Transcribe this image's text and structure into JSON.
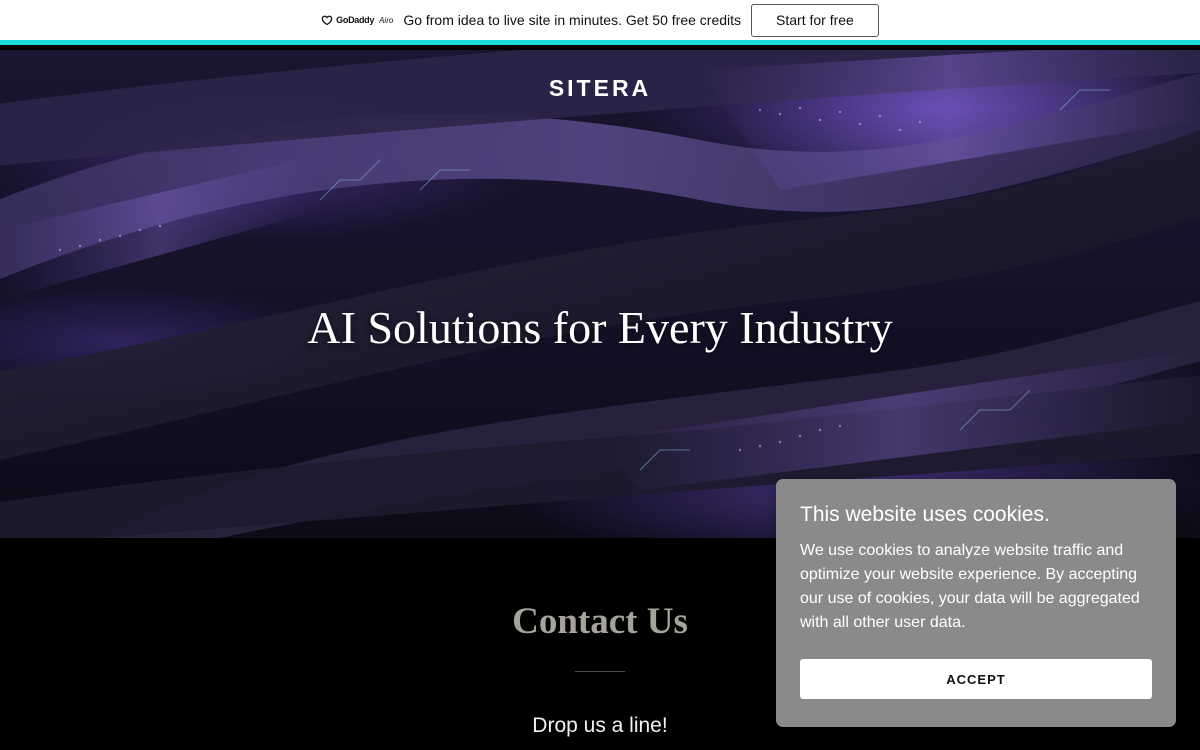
{
  "promo": {
    "logo_text": "GoDaddy",
    "logo_sub": "Airo",
    "message": "Go from idea to live site in minutes. Get 50 free credits",
    "cta_label": "Start for free"
  },
  "header": {
    "brand": "SITERA"
  },
  "hero": {
    "title": "AI Solutions for Every Industry"
  },
  "contact": {
    "title": "Contact Us",
    "subtitle": "Drop us a line!"
  },
  "cookie_banner": {
    "title": "This website uses cookies.",
    "body": "We use cookies to analyze website traffic and optimize your website experience. By accepting our use of cookies, your data will be aggregated with all other user data.",
    "accept_label": "ACCEPT"
  },
  "colors": {
    "promo_accent": "#1bdbdb",
    "cookie_bg": "#8a8a8a",
    "contact_title": "#a5a39b"
  }
}
